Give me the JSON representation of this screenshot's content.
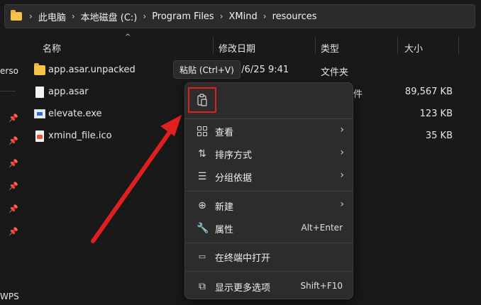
{
  "breadcrumb": {
    "items": [
      "此电脑",
      "本地磁盘 (C:)",
      "Program Files",
      "XMind",
      "resources"
    ]
  },
  "leftnav": {
    "top_label": "erso",
    "bottom_label": "WPS"
  },
  "columns": {
    "name": "名称",
    "date": "修改日期",
    "type": "类型",
    "size": "大小"
  },
  "files": [
    {
      "name": "app.asar.unpacked",
      "date": "2/6/25 9:41",
      "type": "文件夹",
      "size": "",
      "icon": "folder-icon"
    },
    {
      "name": "app.asar",
      "date": "",
      "type": "件",
      "size": "89,567 KB",
      "icon": "file-icon"
    },
    {
      "name": "elevate.exe",
      "date": "",
      "type": "",
      "size": "123 KB",
      "icon": "exe-icon"
    },
    {
      "name": "xmind_file.ico",
      "date": "",
      "type": "",
      "size": "35 KB",
      "icon": "ico-file-icon"
    }
  ],
  "tooltip": "粘贴 (Ctrl+V)",
  "context_menu": {
    "paste_icon": "paste-icon",
    "items": [
      {
        "label": "查看",
        "icon": "view-grid-icon",
        "submenu": true
      },
      {
        "label": "排序方式",
        "icon": "sort-icon",
        "submenu": true
      },
      {
        "label": "分组依据",
        "icon": "group-icon",
        "submenu": true
      },
      {
        "label": "新建",
        "icon": "new-icon",
        "submenu": true
      },
      {
        "label": "属性",
        "icon": "wrench-icon",
        "shortcut": "Alt+Enter"
      },
      {
        "label": "在终端中打开",
        "icon": "terminal-icon"
      },
      {
        "label": "显示更多选项",
        "icon": "more-options-icon",
        "shortcut": "Shift+F10"
      }
    ]
  },
  "colors": {
    "background": "#191919",
    "menu_bg": "#2c2c2c",
    "highlight_red": "#e02020",
    "folder_yellow": "#f5c24a"
  }
}
